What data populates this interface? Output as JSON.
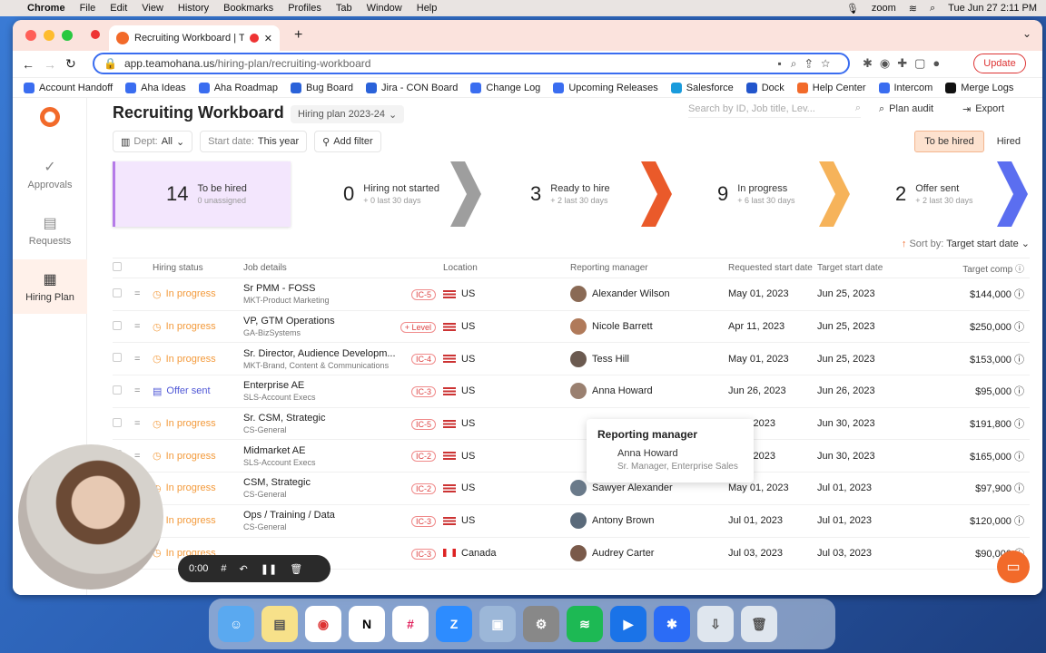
{
  "menubar": {
    "app": "Chrome",
    "items": [
      "File",
      "Edit",
      "View",
      "History",
      "Bookmarks",
      "Profiles",
      "Tab",
      "Window",
      "Help"
    ],
    "zoom": "zoom",
    "clock": "Tue Jun 27  2:11 PM"
  },
  "browser": {
    "tab_title": "Recruiting Workboard | Tea",
    "url_host": "app.teamohana.us",
    "url_path": "/hiring-plan/recruiting-workboard",
    "update_label": "Update",
    "bookmarks": [
      "Account Handoff",
      "Aha Ideas",
      "Aha Roadmap",
      "Bug Board",
      "Jira - CON Board",
      "Change Log",
      "Upcoming Releases",
      "Salesforce",
      "Dock",
      "Help Center",
      "Intercom",
      "Merge Logs"
    ]
  },
  "sidebar": {
    "items": [
      {
        "label": "Approvals",
        "icon": "check-icon"
      },
      {
        "label": "Requests",
        "icon": "document-icon"
      },
      {
        "label": "Hiring Plan",
        "icon": "calendar-icon"
      }
    ]
  },
  "header": {
    "title": "Recruiting Workboard",
    "plan": "Hiring plan 2023-24",
    "search_placeholder": "Search by ID, Job title, Lev...",
    "plan_audit": "Plan audit",
    "export": "Export"
  },
  "filters": {
    "dept_label": "Dept:",
    "dept_value": "All",
    "start_label": "Start date:",
    "start_value": "This year",
    "add_filter": "Add filter",
    "toggle_to_be_hired": "To be hired",
    "toggle_hired": "Hired"
  },
  "stages": [
    {
      "count": "14",
      "label": "To be hired",
      "sub": "0 unassigned",
      "color": "#b57be8"
    },
    {
      "count": "0",
      "label": "Hiring not started",
      "sub": "+ 0 last 30 days",
      "color": "#9e9e9e"
    },
    {
      "count": "3",
      "label": "Ready to hire",
      "sub": "+ 2 last 30 days",
      "color": "#ea5a2a"
    },
    {
      "count": "9",
      "label": "In progress",
      "sub": "+ 6 last 30 days",
      "color": "#f6b35a"
    },
    {
      "count": "2",
      "label": "Offer sent",
      "sub": "+ 2 last 30 days",
      "color": "#5b6ef0"
    }
  ],
  "sort": {
    "label": "Sort by:",
    "value": "Target start date"
  },
  "table": {
    "headers": [
      "Hiring status",
      "Job details",
      "Location",
      "Reporting manager",
      "Requested start date",
      "Target start date",
      "Target comp"
    ],
    "rows": [
      {
        "status": "In progress",
        "title": "Sr PMM - FOSS",
        "dept": "MKT-Product Marketing",
        "level": "IC-5",
        "location": "US",
        "manager": "Alexander Wilson",
        "req": "May 01, 2023",
        "target": "Jun 25, 2023",
        "comp": "$144,000"
      },
      {
        "status": "In progress",
        "title": "VP, GTM Operations",
        "dept": "GA-BizSystems",
        "level": "+ Level",
        "location": "US",
        "manager": "Nicole Barrett",
        "req": "Apr 11, 2023",
        "target": "Jun 25, 2023",
        "comp": "$250,000"
      },
      {
        "status": "In progress",
        "title": "Sr. Director, Audience Developm...",
        "dept": "MKT-Brand, Content & Communications",
        "level": "IC-4",
        "location": "US",
        "manager": "Tess Hill",
        "req": "May 01, 2023",
        "target": "Jun 25, 2023",
        "comp": "$153,000"
      },
      {
        "status": "Offer sent",
        "title": "Enterprise AE",
        "dept": "SLS-Account Execs",
        "level": "IC-3",
        "location": "US",
        "manager": "Anna Howard",
        "req": "Jun 26, 2023",
        "target": "Jun 26, 2023",
        "comp": "$95,000"
      },
      {
        "status": "In progress",
        "title": "Sr. CSM, Strategic",
        "dept": "CS-General",
        "level": "IC-5",
        "location": "US",
        "manager": "",
        "req": "n 30, 2023",
        "target": "Jun 30, 2023",
        "comp": "$191,800"
      },
      {
        "status": "In progress",
        "title": "Midmarket AE",
        "dept": "SLS-Account Execs",
        "level": "IC-2",
        "location": "US",
        "manager": "",
        "req": "n 30, 2023",
        "target": "Jun 30, 2023",
        "comp": "$165,000"
      },
      {
        "status": "In progress",
        "title": "CSM, Strategic",
        "dept": "CS-General",
        "level": "IC-2",
        "location": "US",
        "manager": "Sawyer Alexander",
        "req": "May 01, 2023",
        "target": "Jul 01, 2023",
        "comp": "$97,900"
      },
      {
        "status": "In progress",
        "title": "Ops / Training / Data",
        "dept": "CS-General",
        "level": "IC-3",
        "location": "US",
        "manager": "Antony Brown",
        "req": "Jul 01, 2023",
        "target": "Jul 01, 2023",
        "comp": "$120,000"
      },
      {
        "status": "In progress",
        "title": "",
        "dept": "",
        "level": "IC-3",
        "location": "Canada",
        "manager": "Audrey Carter",
        "req": "Jul 03, 2023",
        "target": "Jul 03, 2023",
        "comp": "$90,000"
      }
    ]
  },
  "tooltip": {
    "title": "Reporting manager",
    "name": "Anna Howard",
    "role": "Sr. Manager, Enterprise Sales"
  },
  "recorder": {
    "time": "0:00"
  }
}
